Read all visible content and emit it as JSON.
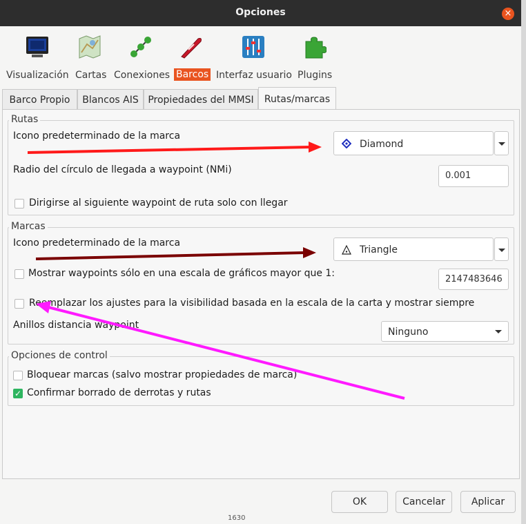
{
  "window": {
    "title": "Opciones",
    "close_symbol": "×"
  },
  "toolbar": [
    {
      "label": "Visualización",
      "icon": "monitor-icon"
    },
    {
      "label": "Cartas",
      "icon": "chart-map-icon"
    },
    {
      "label": "Conexiones",
      "icon": "connections-icon"
    },
    {
      "label": "Barcos",
      "icon": "boat-icon",
      "selected": true
    },
    {
      "label": "Interfaz usuario",
      "icon": "sliders-icon"
    },
    {
      "label": "Plugins",
      "icon": "puzzle-icon"
    }
  ],
  "tabs": [
    {
      "label": "Barco Propio"
    },
    {
      "label": "Blancos AIS"
    },
    {
      "label": "Propiedades del MMSI"
    },
    {
      "label": "Rutas/marcas",
      "active": true
    }
  ],
  "rutas": {
    "title": "Rutas",
    "default_icon_label": "Icono predeterminado de la marca",
    "default_icon_value": "Diamond",
    "arrival_radius_label": "Radio del círculo de llegada a waypoint (NMi)",
    "arrival_radius_value": "0.001",
    "advance_label": "Dirigirse al siguiente waypoint de ruta solo con llegar",
    "advance_checked": false
  },
  "marcas": {
    "title": "Marcas",
    "default_icon_label": "Icono predeterminado de la marca",
    "default_icon_value": "Triangle",
    "show_scale_label": "Mostrar waypoints sólo en una escala de gráficos mayor que 1:",
    "show_scale_checked": false,
    "scale_value": "2147483646",
    "override_label": "Reemplazar los ajustes para la visibilidad basada en la escala de la carta y mostrar siempre",
    "override_checked": false,
    "rings_label": "Anillos distancia waypoint",
    "rings_value": "Ninguno"
  },
  "control": {
    "title": "Opciones de control",
    "lock_label": "Bloquear marcas (salvo mostrar propiedades de marca)",
    "lock_checked": false,
    "confirm_label": "Confirmar borrado de derrotas y rutas",
    "confirm_checked": true,
    "check_mark": "✓"
  },
  "buttons": {
    "ok": "OK",
    "cancel": "Cancelar",
    "apply": "Aplicar"
  },
  "background_fragment": "1630",
  "annotation_colors": {
    "red": "#ff1a1a",
    "dark_red": "#7a0000",
    "magenta": "#ff1aff"
  }
}
